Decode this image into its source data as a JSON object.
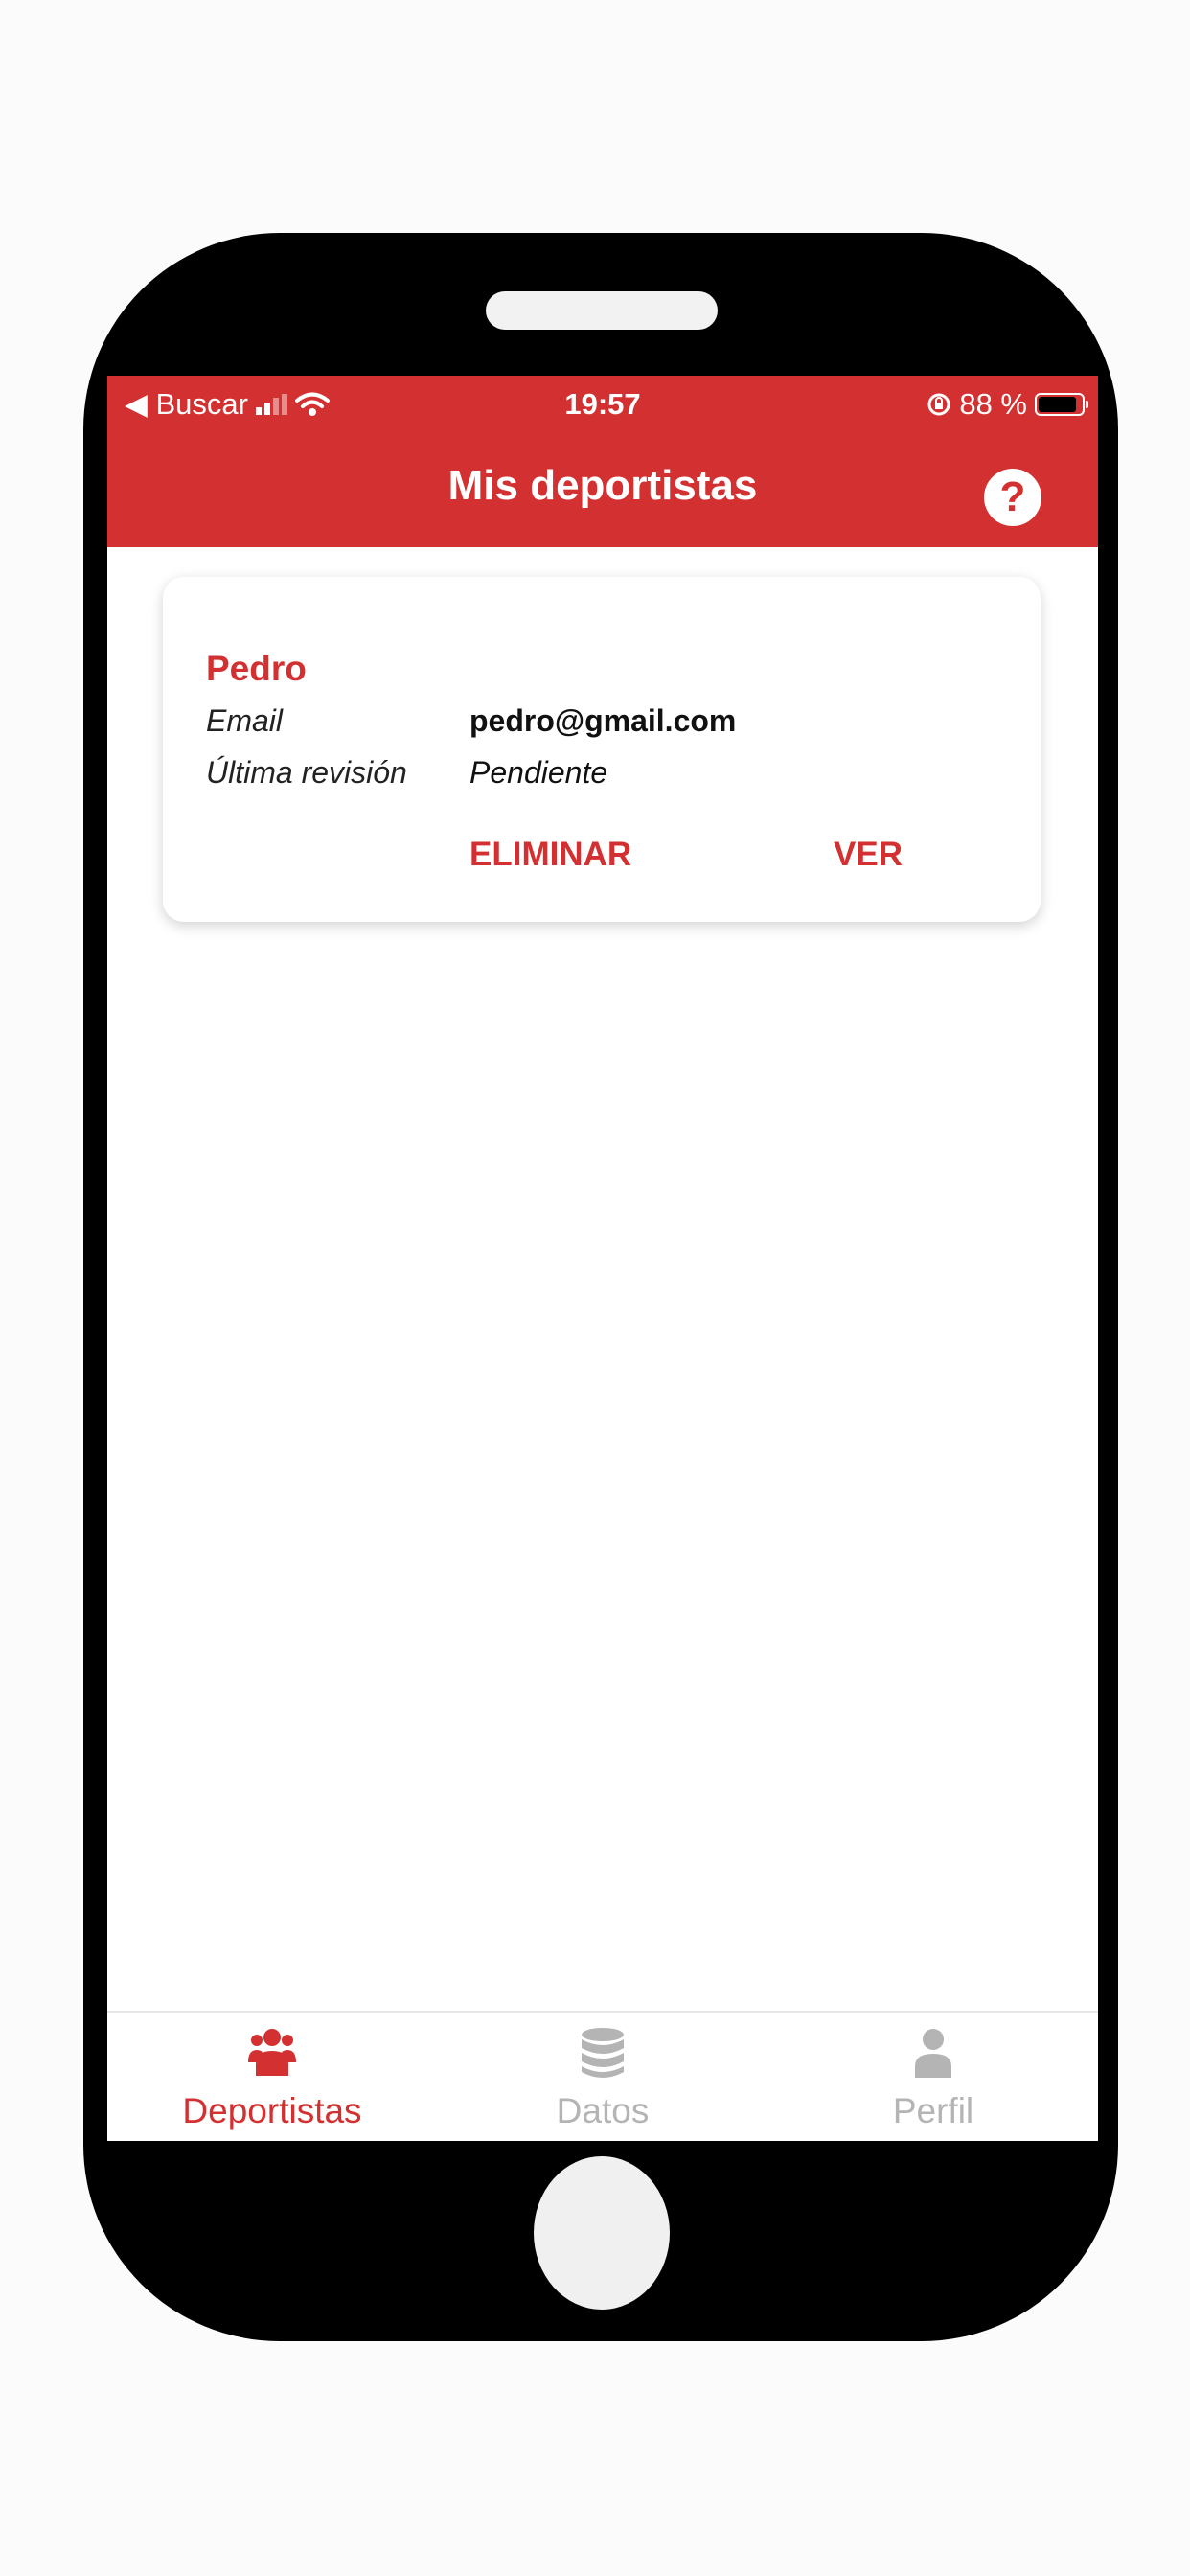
{
  "status_bar": {
    "back_label": "◀ Buscar",
    "time": "19:57",
    "battery_text": "88 %",
    "battery_level": 0.88
  },
  "header": {
    "title": "Mis deportistas"
  },
  "athlete_card": {
    "name": "Pedro",
    "email_label": "Email",
    "email_value": "pedro@gmail.com",
    "review_label": "Última revisión",
    "review_value": "Pendiente",
    "delete_label": "ELIMINAR",
    "view_label": "VER"
  },
  "tabbar": {
    "tabs": [
      {
        "label": "Deportistas",
        "icon": "users-icon"
      },
      {
        "label": "Datos",
        "icon": "database-icon"
      },
      {
        "label": "Perfil",
        "icon": "user-icon"
      }
    ]
  },
  "colors": {
    "brand": "#d33131",
    "inactive_tab": "#b4b4b4"
  }
}
